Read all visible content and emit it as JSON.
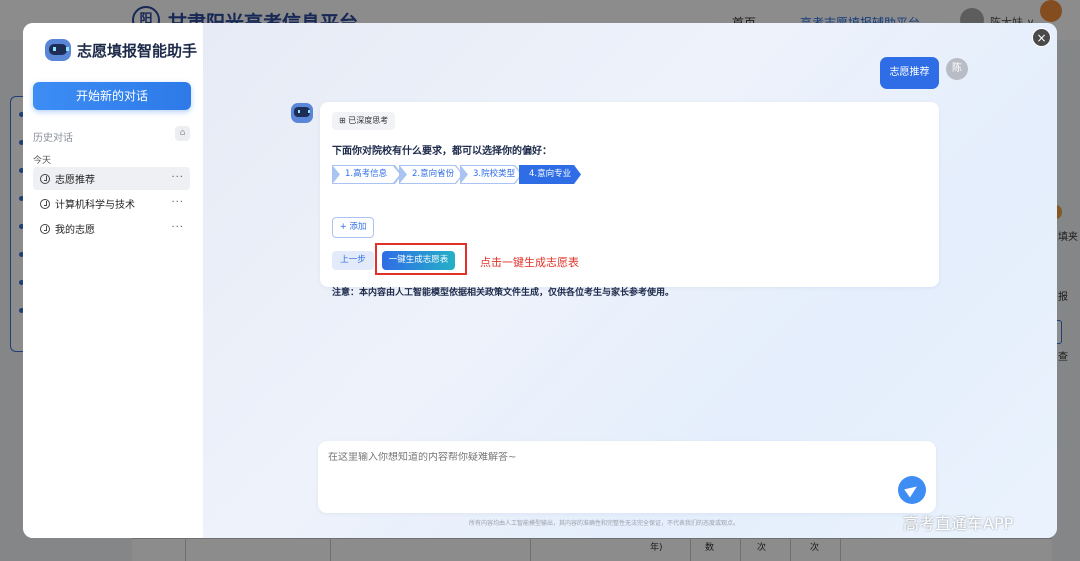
{
  "background": {
    "site_title": "甘肃阳光高考信息平台",
    "nav_home": "首页",
    "nav_assist": "高考志愿填报辅助平台",
    "user_name": "陈大妹 ∨",
    "logo_glyph": "阳",
    "right_texts": [
      "填夹",
      "报",
      "查"
    ],
    "table_texts": [
      "年)",
      "数",
      "次",
      "次"
    ]
  },
  "sidebar": {
    "brand_title": "志愿填报智能助手",
    "new_chat_label": "开始新的对话",
    "history_label": "历史对话",
    "today_label": "今天",
    "items": [
      {
        "label": "志愿推荐",
        "active": true
      },
      {
        "label": "计算机科学与技术",
        "active": false
      },
      {
        "label": "我的志愿",
        "active": false
      }
    ],
    "more_label": "···"
  },
  "chat": {
    "user_message": "志愿推荐",
    "user_avatar_text": "陈",
    "think_tag": "⊞ 已深度思考",
    "prompt": "下面你对院校有什么要求，都可以选择你的偏好：",
    "steps": [
      {
        "label": "1.高考信息",
        "active": false
      },
      {
        "label": "2.意向省份",
        "active": false
      },
      {
        "label": "3.院校类型",
        "active": false
      },
      {
        "label": "4.意向专业",
        "active": true
      }
    ],
    "add_label": "+ 添加",
    "prev_label": "上一步",
    "generate_label": "一键生成志愿表",
    "hint": "点击一键生成志愿表",
    "notice": "注意：本内容由人工智能模型依据相关政策文件生成，仅供各位考生与家长参考使用。"
  },
  "input": {
    "placeholder": "在这里输入你想知道的内容帮你疑难解答~",
    "value": ""
  },
  "disclaimer": "所有内容均由人工智能模型输出，其内容的准确性和完整性无法完全保证，不代表我们的态度或观点。",
  "close_label": "×",
  "watermark": "高考直通车APP",
  "colors": {
    "accent": "#2f6de6",
    "highlight": "#e0322a",
    "gradient_end": "#25b0c6"
  }
}
